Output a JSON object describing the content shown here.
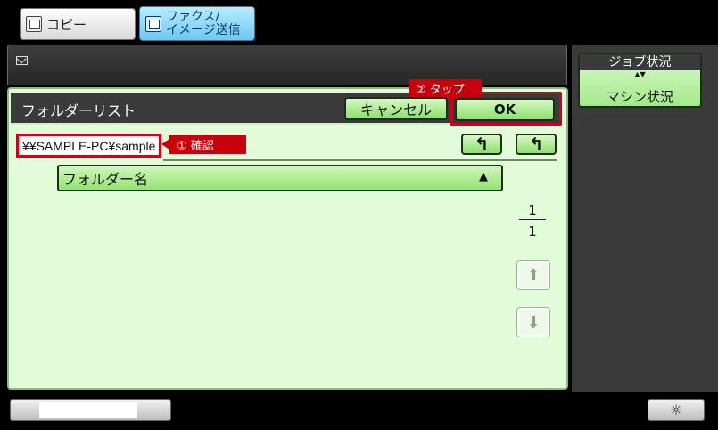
{
  "modes": {
    "copy_label": "コピー",
    "fax_label": "ファクス/\nイメージ送信"
  },
  "status_bar": {
    "icon": "mail-icon"
  },
  "dialog": {
    "title": "フォルダーリスト",
    "cancel_label": "キャンセル",
    "ok_label": "OK",
    "path": "¥¥SAMPLE-PC¥sample",
    "nav_top_icon": "↰",
    "nav_up_icon": "↰",
    "column_header": "フォルダー名",
    "sort_icon": "▲",
    "page_current": "1",
    "page_total": "1",
    "scroll_up_icon": "⬆",
    "scroll_down_icon": "⬇"
  },
  "annotations": {
    "tap_label": "② タップ",
    "confirm_label": "① 確認",
    "highlight_color": "#d3001b"
  },
  "side_panel": {
    "job_status": "ジョブ状況",
    "machine_status": "マシン状況",
    "toggle_icon": "▲▼"
  },
  "bottom": {
    "brightness_icon": "☼"
  },
  "colors": {
    "panel_bg": "#e2fbd9",
    "button_green": "#8be06a",
    "title_bar": "#3a3a3a",
    "fax_tab": "#6cc8f1"
  }
}
